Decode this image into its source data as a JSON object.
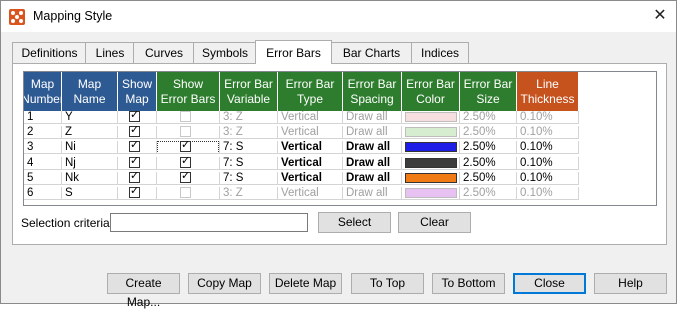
{
  "window": {
    "title": "Mapping Style",
    "close_glyph": "✕",
    "icon": "mapping-style-icon"
  },
  "tabs": [
    {
      "label": "Definitions"
    },
    {
      "label": "Lines"
    },
    {
      "label": "Curves"
    },
    {
      "label": "Symbols"
    },
    {
      "label": "Error Bars",
      "active": true
    },
    {
      "label": "Bar Charts"
    },
    {
      "label": "Indices"
    }
  ],
  "table": {
    "headers": [
      {
        "label": "Map\nNumber",
        "color": "#2e5a93"
      },
      {
        "label": "Map\nName",
        "color": "#2e5a93"
      },
      {
        "label": "Show\nMap",
        "color": "#2e5a93"
      },
      {
        "label": "Show\nError Bars",
        "color": "#2e7d2e"
      },
      {
        "label": "Error Bar\nVariable",
        "color": "#2e7d2e"
      },
      {
        "label": "Error Bar\nType",
        "color": "#2e7d2e"
      },
      {
        "label": "Error Bar\nSpacing",
        "color": "#2e7d2e"
      },
      {
        "label": "Error Bar\nColor",
        "color": "#2e7d2e"
      },
      {
        "label": "Error Bar\nSize",
        "color": "#2e7d2e"
      },
      {
        "label": "Line\nThickness",
        "color": "#c6521e"
      }
    ],
    "rows": [
      {
        "num": "1",
        "name": "Y",
        "show_map": true,
        "show_err": false,
        "active": false,
        "variable": "3: Z",
        "type": "Vertical",
        "spacing": "Draw all",
        "color": "#f4c6c6",
        "size": "2.50%",
        "thickness": "0.10%"
      },
      {
        "num": "2",
        "name": "Z",
        "show_map": true,
        "show_err": false,
        "active": false,
        "variable": "3: Z",
        "type": "Vertical",
        "spacing": "Draw all",
        "color": "#b7e0a8",
        "size": "2.50%",
        "thickness": "0.10%"
      },
      {
        "num": "3",
        "name": "Ni",
        "show_map": true,
        "show_err": true,
        "active": true,
        "variable": "7: S",
        "type": "Vertical",
        "spacing": "Draw all",
        "color": "#1e1ee6",
        "size": "2.50%",
        "thickness": "0.10%",
        "focused": true
      },
      {
        "num": "4",
        "name": "Nj",
        "show_map": true,
        "show_err": true,
        "active": true,
        "variable": "7: S",
        "type": "Vertical",
        "spacing": "Draw all",
        "color": "#3c3c3c",
        "size": "2.50%",
        "thickness": "0.10%"
      },
      {
        "num": "5",
        "name": "Nk",
        "show_map": true,
        "show_err": true,
        "active": true,
        "variable": "7: S",
        "type": "Vertical",
        "spacing": "Draw all",
        "color": "#f07a14",
        "size": "2.50%",
        "thickness": "0.10%"
      },
      {
        "num": "6",
        "name": "S",
        "show_map": true,
        "show_err": false,
        "active": false,
        "variable": "3: Z",
        "type": "Vertical",
        "spacing": "Draw all",
        "color": "#d48fe6",
        "size": "2.50%",
        "thickness": "0.10%"
      }
    ],
    "check_glyph": "✓"
  },
  "selection": {
    "label": "Selection criteria:",
    "value": "",
    "select_label": "Select",
    "clear_label": "Clear"
  },
  "buttons": [
    {
      "label": "Create Map...",
      "name": "create-map-button"
    },
    {
      "label": "Copy Map",
      "name": "copy-map-button"
    },
    {
      "label": "Delete Map",
      "name": "delete-map-button"
    },
    {
      "label": "To Top",
      "name": "to-top-button"
    },
    {
      "label": "To Bottom",
      "name": "to-bottom-button"
    },
    {
      "label": "Close",
      "name": "close-button",
      "default": true
    },
    {
      "label": "Help",
      "name": "help-button"
    }
  ]
}
